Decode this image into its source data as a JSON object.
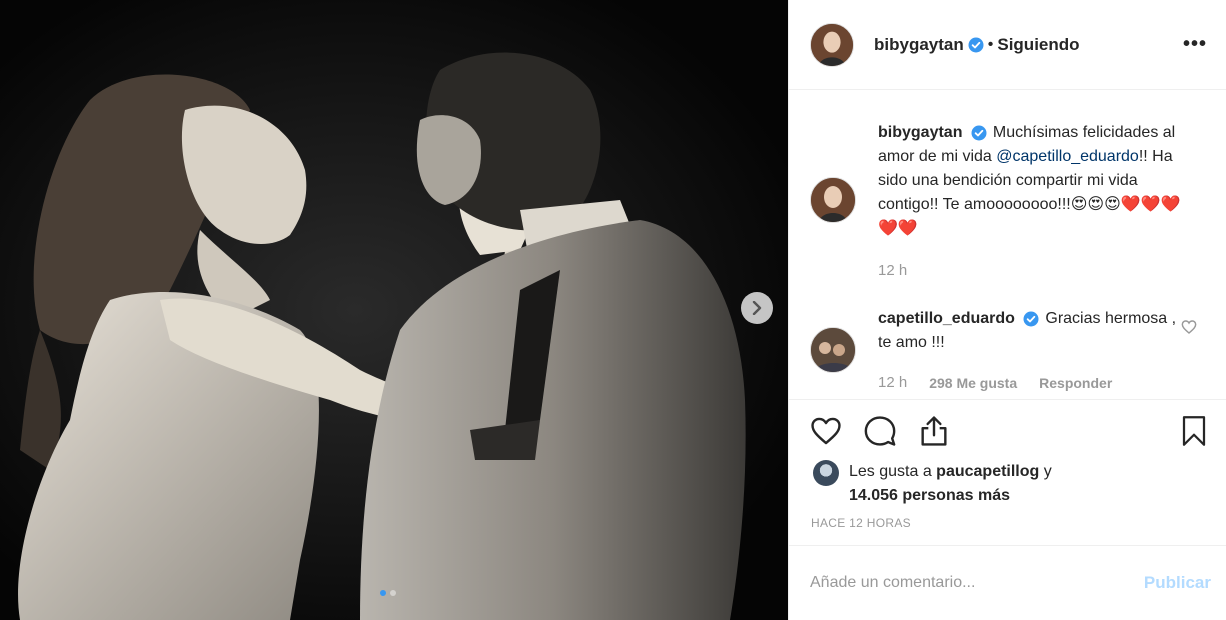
{
  "post": {
    "author": "bibygaytan",
    "follow_separator": "•",
    "follow_status": "Siguiendo",
    "more_label": "•••",
    "carousel_count": 2,
    "carousel_active": 1
  },
  "caption": {
    "username": "bibygaytan",
    "text_before": "Muchísimas felicidades al amor de mi vida ",
    "mention": "@capetillo_eduardo",
    "text_after": "!! Ha sido una bendición compartir mi vida contigo!! Te amoooooooo!!!😍😍😍❤️❤️❤️❤️❤️",
    "time": "12 h"
  },
  "reply": {
    "username": "capetillo_eduardo",
    "text": "Gracias hermosa , te amo !!!",
    "time": "12 h",
    "likes": "298 Me gusta",
    "reply_label": "Responder"
  },
  "likes": {
    "prefix": "Les gusta a ",
    "user": "paucapetillog",
    "middle": " y",
    "count_text": "14.056 personas más"
  },
  "timestamp": "HACE 12 HORAS",
  "comment_box": {
    "placeholder": "Añade un comentario...",
    "publish_label": "Publicar"
  },
  "colors": {
    "verified": "#3897f0",
    "mention": "#003569",
    "publish_disabled": "#b3dbff",
    "muted": "#999999"
  },
  "icons": [
    "heart-icon",
    "comment-icon",
    "share-icon",
    "bookmark-icon",
    "verified-badge-icon",
    "chevron-right-icon"
  ]
}
